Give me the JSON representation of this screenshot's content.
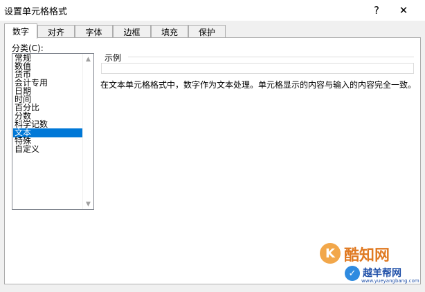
{
  "window": {
    "title": "设置单元格格式",
    "help_glyph": "?",
    "close_glyph": "✕"
  },
  "tabs": [
    {
      "label": "数字",
      "active": true
    },
    {
      "label": "对齐",
      "active": false
    },
    {
      "label": "字体",
      "active": false
    },
    {
      "label": "边框",
      "active": false
    },
    {
      "label": "填充",
      "active": false
    },
    {
      "label": "保护",
      "active": false
    }
  ],
  "category": {
    "label": "分类(C):",
    "items": [
      "常规",
      "数值",
      "货币",
      "会计专用",
      "日期",
      "时间",
      "百分比",
      "分数",
      "科学记数",
      "文本",
      "特殊",
      "自定义"
    ],
    "selected": "文本"
  },
  "sample": {
    "label": "示例",
    "value": ""
  },
  "description": "在文本单元格格式中，数字作为文本处理。单元格显示的内容与输入的内容完全一致。",
  "watermarks": {
    "logo1_glyph": "K",
    "logo1_text": "酷知网",
    "logo2_glyph": "✓",
    "logo2_text": "越羊帮网",
    "logo2_url": "www.yueyangbang.com"
  }
}
